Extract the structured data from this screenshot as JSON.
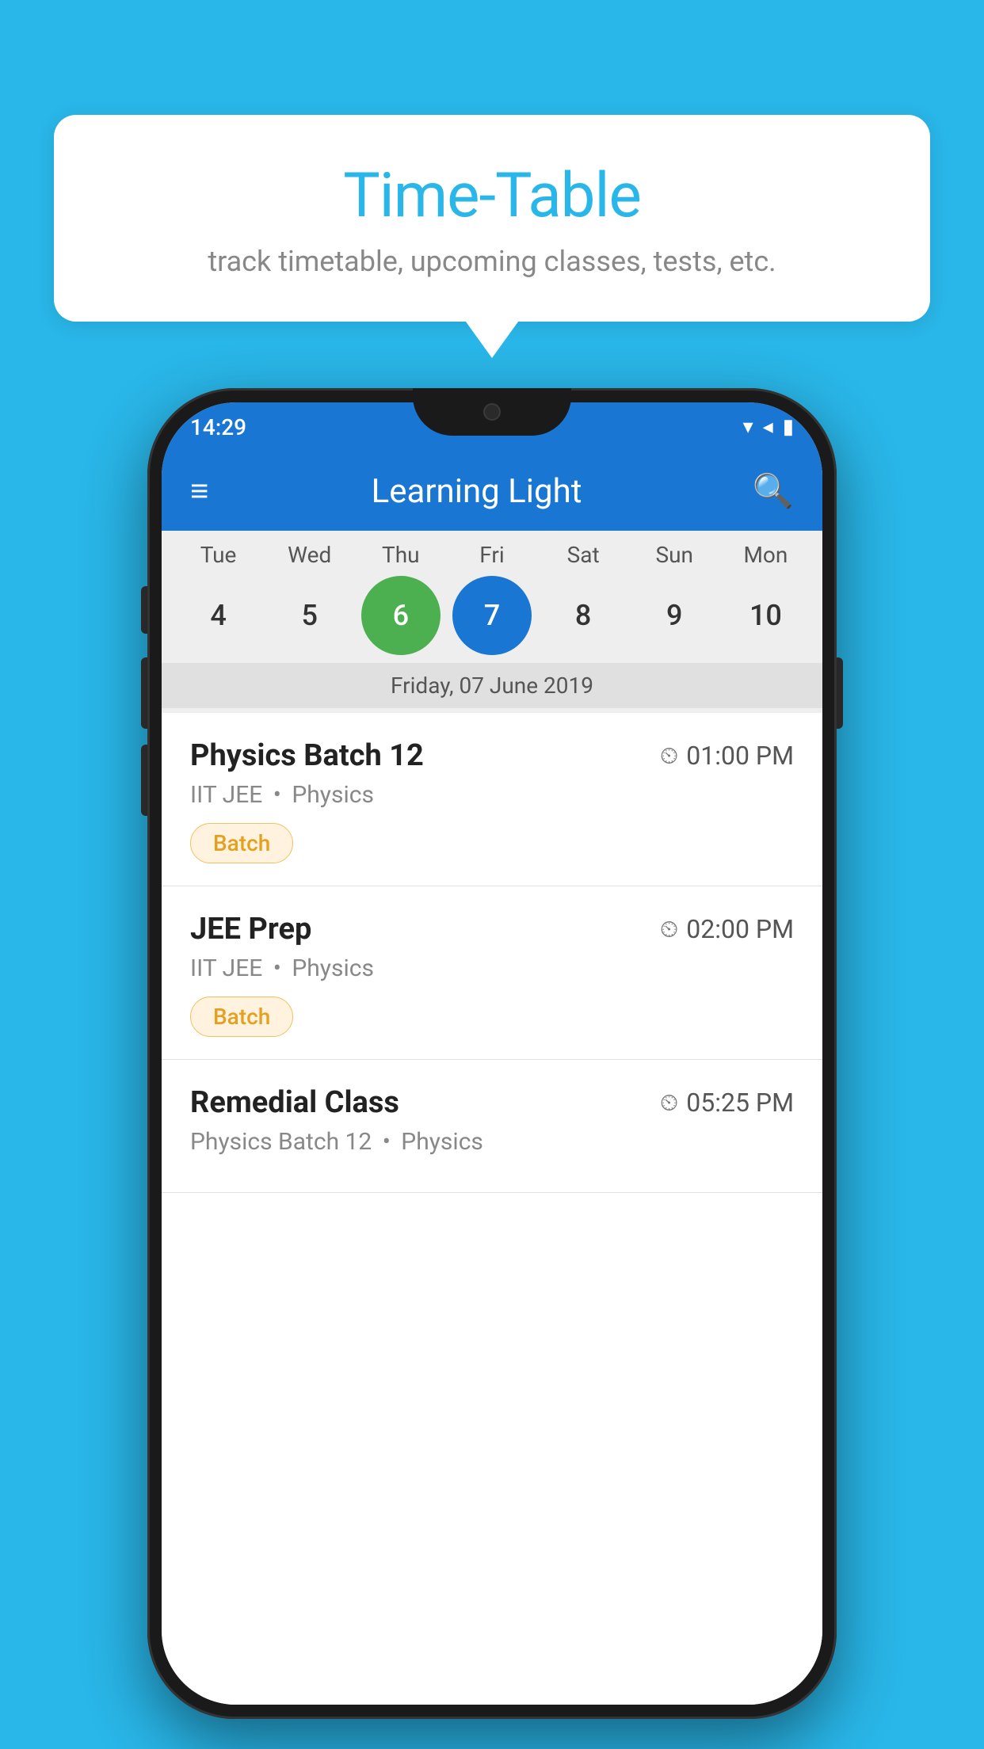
{
  "background_color": "#29b6e8",
  "tooltip": {
    "title": "Time-Table",
    "subtitle": "track timetable, upcoming classes, tests, etc."
  },
  "phone": {
    "status_bar": {
      "time": "14:29"
    },
    "app_bar": {
      "title": "Learning Light"
    },
    "calendar": {
      "days": [
        {
          "label": "Tue",
          "num": "4"
        },
        {
          "label": "Wed",
          "num": "5"
        },
        {
          "label": "Thu",
          "num": "6",
          "state": "today"
        },
        {
          "label": "Fri",
          "num": "7",
          "state": "selected"
        },
        {
          "label": "Sat",
          "num": "8"
        },
        {
          "label": "Sun",
          "num": "9"
        },
        {
          "label": "Mon",
          "num": "10"
        }
      ],
      "selected_date": "Friday, 07 June 2019"
    },
    "schedule": [
      {
        "name": "Physics Batch 12",
        "time": "01:00 PM",
        "sub_label": "IIT JEE",
        "sub_subject": "Physics",
        "tag": "Batch"
      },
      {
        "name": "JEE Prep",
        "time": "02:00 PM",
        "sub_label": "IIT JEE",
        "sub_subject": "Physics",
        "tag": "Batch"
      },
      {
        "name": "Remedial Class",
        "time": "05:25 PM",
        "sub_label": "Physics Batch 12",
        "sub_subject": "Physics",
        "tag": ""
      }
    ]
  }
}
